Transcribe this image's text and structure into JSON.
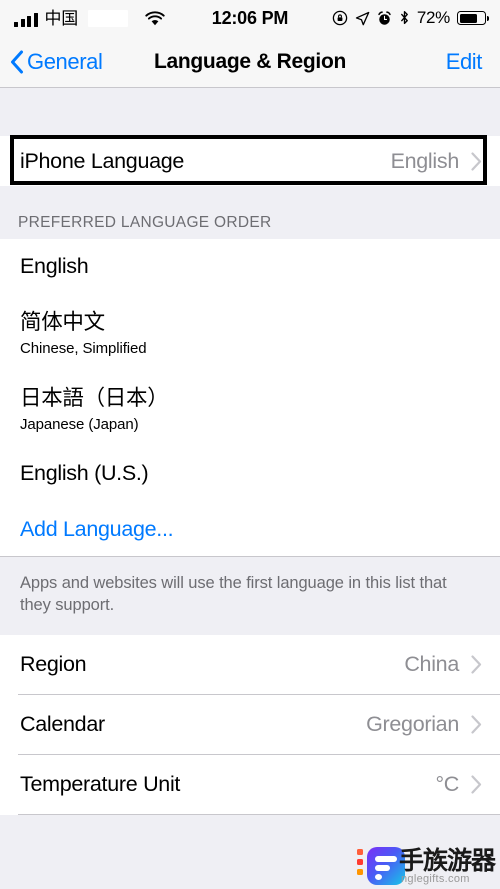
{
  "status_bar": {
    "carrier": "中国",
    "carrier_redacted": true,
    "signal_bars": 4,
    "wifi_icon": "wifi-icon",
    "time": "12:06 PM",
    "icons": [
      "rotation-lock-icon",
      "location-arrow-icon",
      "alarm-clock-icon",
      "bluetooth-icon"
    ],
    "battery_percent": "72%",
    "battery_level": 72
  },
  "nav": {
    "back_label": "General",
    "back_icon": "chevron-left-icon",
    "title": "Language & Region",
    "edit_label": "Edit"
  },
  "iphone_language": {
    "title": "iPhone Language",
    "value": "English",
    "chevron": "chevron-right-icon",
    "highlighted": true
  },
  "preferred_section": {
    "header": "PREFERRED LANGUAGE ORDER",
    "items": [
      {
        "title": "English",
        "subtitle": ""
      },
      {
        "title": "简体中文",
        "subtitle": "Chinese, Simplified"
      },
      {
        "title": "日本語（日本）",
        "subtitle": "Japanese (Japan)"
      },
      {
        "title": "English (U.S.)",
        "subtitle": ""
      }
    ],
    "add_language_label": "Add Language...",
    "footer": "Apps and websites will use the first language in this list that they support."
  },
  "region_section": {
    "rows": [
      {
        "title": "Region",
        "value": "China",
        "chevron": "chevron-right-icon"
      },
      {
        "title": "Calendar",
        "value": "Gregorian",
        "chevron": "chevron-right-icon"
      },
      {
        "title": "Temperature Unit",
        "value": "°C",
        "chevron": "chevron-right-icon"
      }
    ]
  },
  "watermark": {
    "text": "手族游器",
    "url": "nglegifts.com"
  },
  "colors": {
    "accent_blue": "#007AFF",
    "group_background": "#EFEFF4",
    "row_background": "#FFFFFF",
    "secondary_text": "#8E8E93",
    "separator": "#C8C7CC",
    "highlight_border": "#000000"
  }
}
